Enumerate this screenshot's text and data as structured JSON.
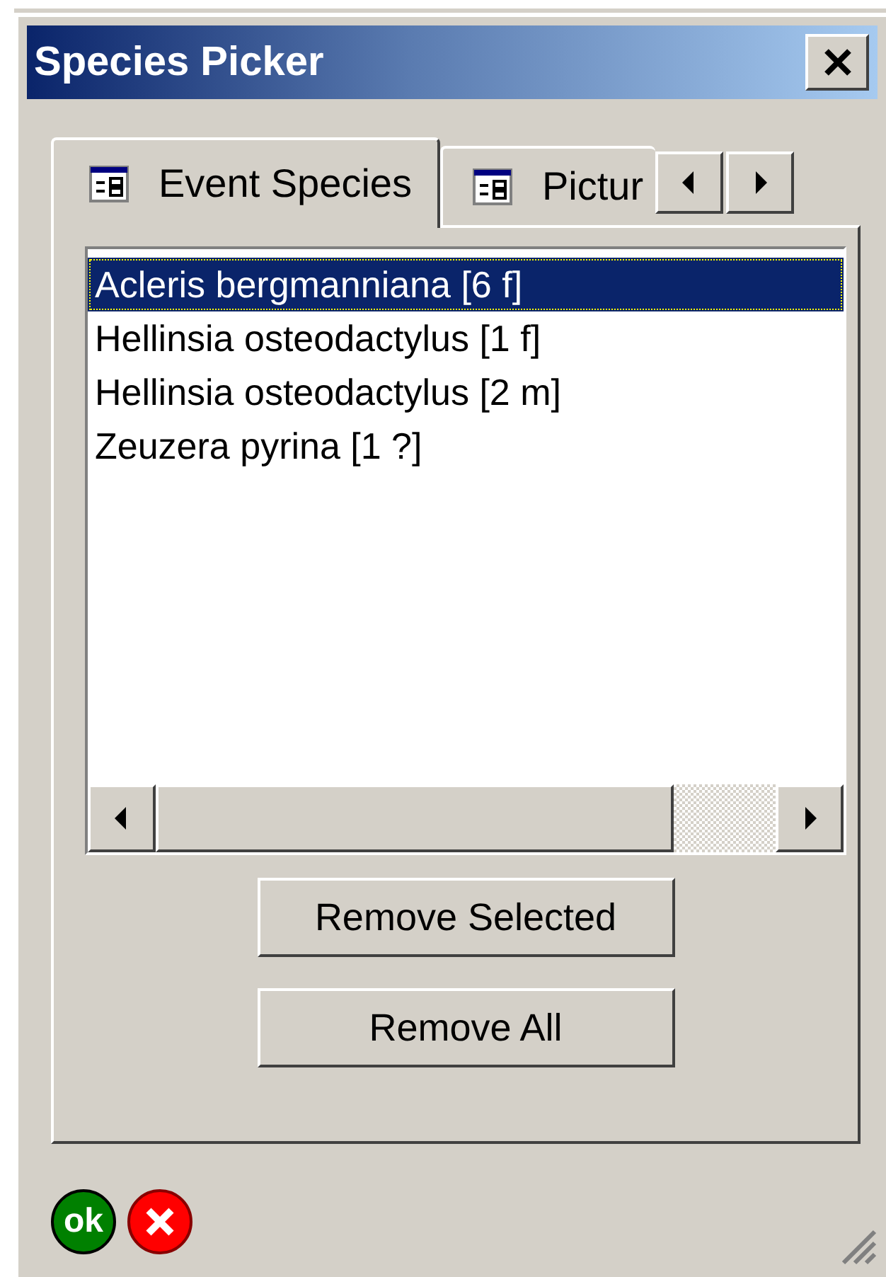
{
  "window": {
    "title": "Species Picker"
  },
  "tabs": [
    {
      "label": "Event Species",
      "selected": true
    },
    {
      "label": "Pictur",
      "selected": false
    }
  ],
  "species_list": [
    {
      "label": "Acleris bergmanniana [6 f]",
      "selected": true
    },
    {
      "label": "Hellinsia osteodactylus [1 f]",
      "selected": false
    },
    {
      "label": "Hellinsia osteodactylus [2 m]",
      "selected": false
    },
    {
      "label": "Zeuzera pyrina [1 ?]",
      "selected": false
    }
  ],
  "buttons": [
    "Remove Selected",
    "Remove All"
  ],
  "footer": {
    "ok_label": "ok"
  }
}
